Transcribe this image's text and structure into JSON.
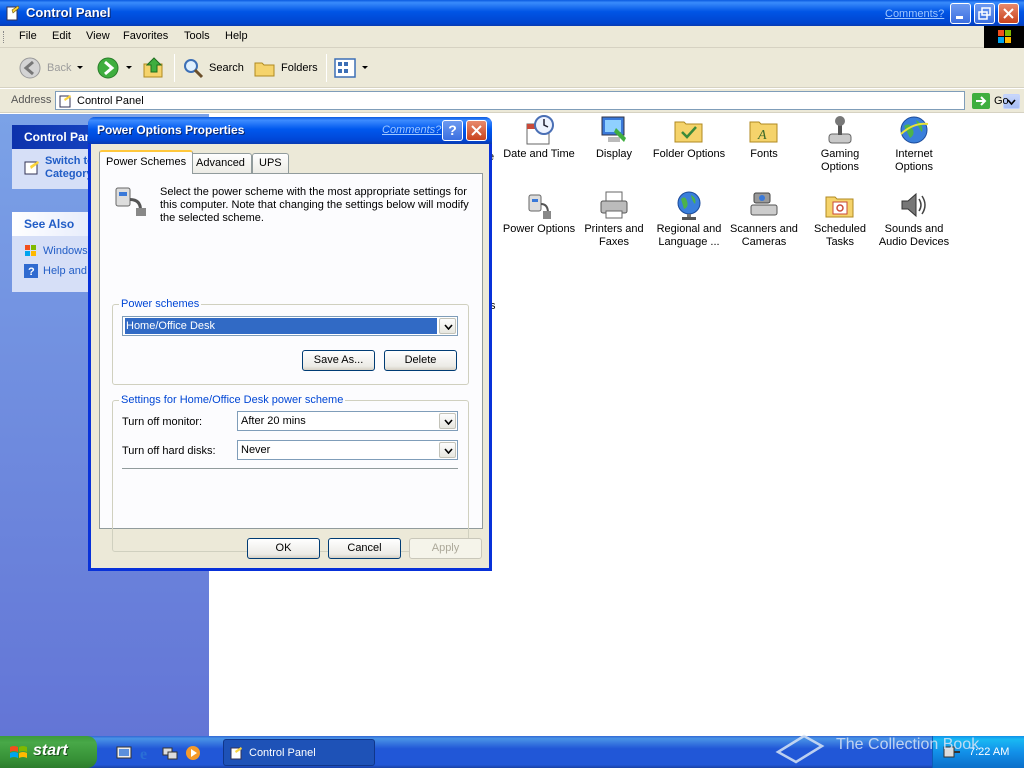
{
  "window": {
    "title": "Control Panel",
    "comments_link": "Comments?"
  },
  "menu": [
    "File",
    "Edit",
    "View",
    "Favorites",
    "Tools",
    "Help"
  ],
  "toolbar": {
    "back_label": "Back",
    "search_label": "Search",
    "folders_label": "Folders"
  },
  "address": {
    "label": "Address",
    "value": "Control Panel",
    "go_label": "Go"
  },
  "left_pane": {
    "control_panel_header": "Control Panel",
    "switch_view": "Switch to Category View",
    "see_also_header": "See Also",
    "see_also_items": [
      "Windows Update",
      "Help and Support"
    ]
  },
  "content": {
    "fragment_e": "e",
    "fragment_ts": "ts",
    "items_row1": [
      {
        "label": "Date and Time",
        "icon": "clock-icon"
      },
      {
        "label": "Display",
        "icon": "display-icon"
      },
      {
        "label": "Folder Options",
        "icon": "folder-options-icon"
      },
      {
        "label": "Fonts",
        "icon": "fonts-folder-icon"
      },
      {
        "label": "Gaming Options",
        "icon": "joystick-icon"
      },
      {
        "label": "Internet Options",
        "icon": "globe-icon"
      }
    ],
    "items_row2": [
      {
        "label": "Power Options",
        "icon": "power-icon"
      },
      {
        "label": "Printers and Faxes",
        "icon": "printer-icon"
      },
      {
        "label": "Regional and Language ...",
        "icon": "regional-globe-icon"
      },
      {
        "label": "Scanners and Cameras",
        "icon": "scanner-icon"
      },
      {
        "label": "Scheduled Tasks",
        "icon": "scheduled-tasks-icon"
      },
      {
        "label": "Sounds and Audio Devices",
        "icon": "speaker-icon"
      }
    ]
  },
  "dialog": {
    "title": "Power Options Properties",
    "comments_link": "Comments?",
    "help_label": "?",
    "tabs": [
      "Power Schemes",
      "Advanced",
      "UPS"
    ],
    "intro": "Select the power scheme with the most appropriate settings for this computer. Note that changing the settings below will modify the selected scheme.",
    "schemes_legend": "Power schemes",
    "scheme_value": "Home/Office Desk",
    "save_as_label": "Save As...",
    "delete_label": "Delete",
    "settings_legend": "Settings for Home/Office Desk power scheme",
    "monitor_label": "Turn off monitor:",
    "monitor_value": "After 20 mins",
    "disks_label": "Turn off hard disks:",
    "disks_value": "Never",
    "ok_label": "OK",
    "cancel_label": "Cancel",
    "apply_label": "Apply"
  },
  "taskbar": {
    "start_label": "start",
    "task_label": "Control Panel",
    "clock": "7:22 AM"
  },
  "watermark": "The Collection Book",
  "colors": {
    "xp_blue": "#0055e5",
    "start_green": "#379237",
    "link_blue": "#215dc6",
    "selection": "#316ac5"
  }
}
